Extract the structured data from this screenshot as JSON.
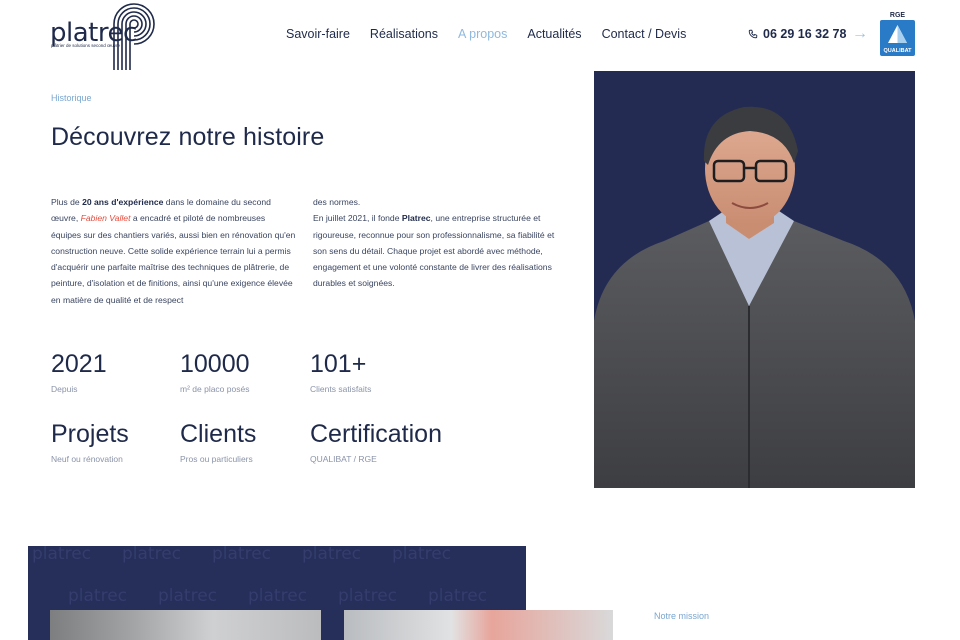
{
  "brand": {
    "name": "platrec",
    "tagline": "plâtrier de solutions second œuvre"
  },
  "nav": {
    "items": [
      {
        "label": "Savoir-faire"
      },
      {
        "label": "Réalisations"
      },
      {
        "label": "A propos",
        "active": true
      },
      {
        "label": "Actualités"
      },
      {
        "label": "Contact / Devis"
      }
    ]
  },
  "contact": {
    "phone": "06 29 16 32 78",
    "phone_icon": "phone-icon",
    "arrow_icon": "arrow-right-icon"
  },
  "badge": {
    "top": "RGE",
    "bottom": "QUALIBAT"
  },
  "history": {
    "eyebrow": "Historique",
    "title": "Découvrez notre histoire",
    "col1": {
      "t1": "Plus de ",
      "b1": "20 ans d'expérience",
      "t2": " dans le domaine du second œuvre, ",
      "em1": "Fabien Vallet",
      "t3": " a encadré et piloté de nombreuses équipes sur des chantiers variés, aussi bien en rénovation qu'en construction neuve. Cette solide expérience terrain lui a permis d'acquérir une parfaite maîtrise des techniques de plâtrerie, de peinture, d'isolation et de finitions, ainsi qu'une exigence élevée en matière de qualité et de respect"
    },
    "col2": {
      "t1": "des normes.",
      "t2": "En juillet 2021, il fonde ",
      "b1": "Platrec",
      "t3": ", une entreprise structurée et rigoureuse, reconnue pour son professionnalisme, sa fiabilité et son sens du détail. Chaque projet est abordé avec méthode, engagement et une volonté constante de livrer des réalisations durables et soignées."
    }
  },
  "stats": [
    {
      "value": "2021",
      "label": "Depuis"
    },
    {
      "value": "10000",
      "label": "m² de placo posés"
    },
    {
      "value": "101+",
      "label": "Clients satisfaits"
    },
    {
      "value": "Projets",
      "label": "Neuf ou rénovation"
    },
    {
      "value": "Clients",
      "label": "Pros ou particuliers"
    },
    {
      "value": "Certification",
      "label": "QUALIBAT / RGE"
    }
  ],
  "mission": {
    "eyebrow": "Notre mission"
  },
  "colors": {
    "navy": "#1f2a4a",
    "accent_blue": "#8fb9de",
    "highlight_red": "#e64b3c",
    "portrait_bg": "#232b52",
    "badge_blue": "#2a7bc7"
  }
}
